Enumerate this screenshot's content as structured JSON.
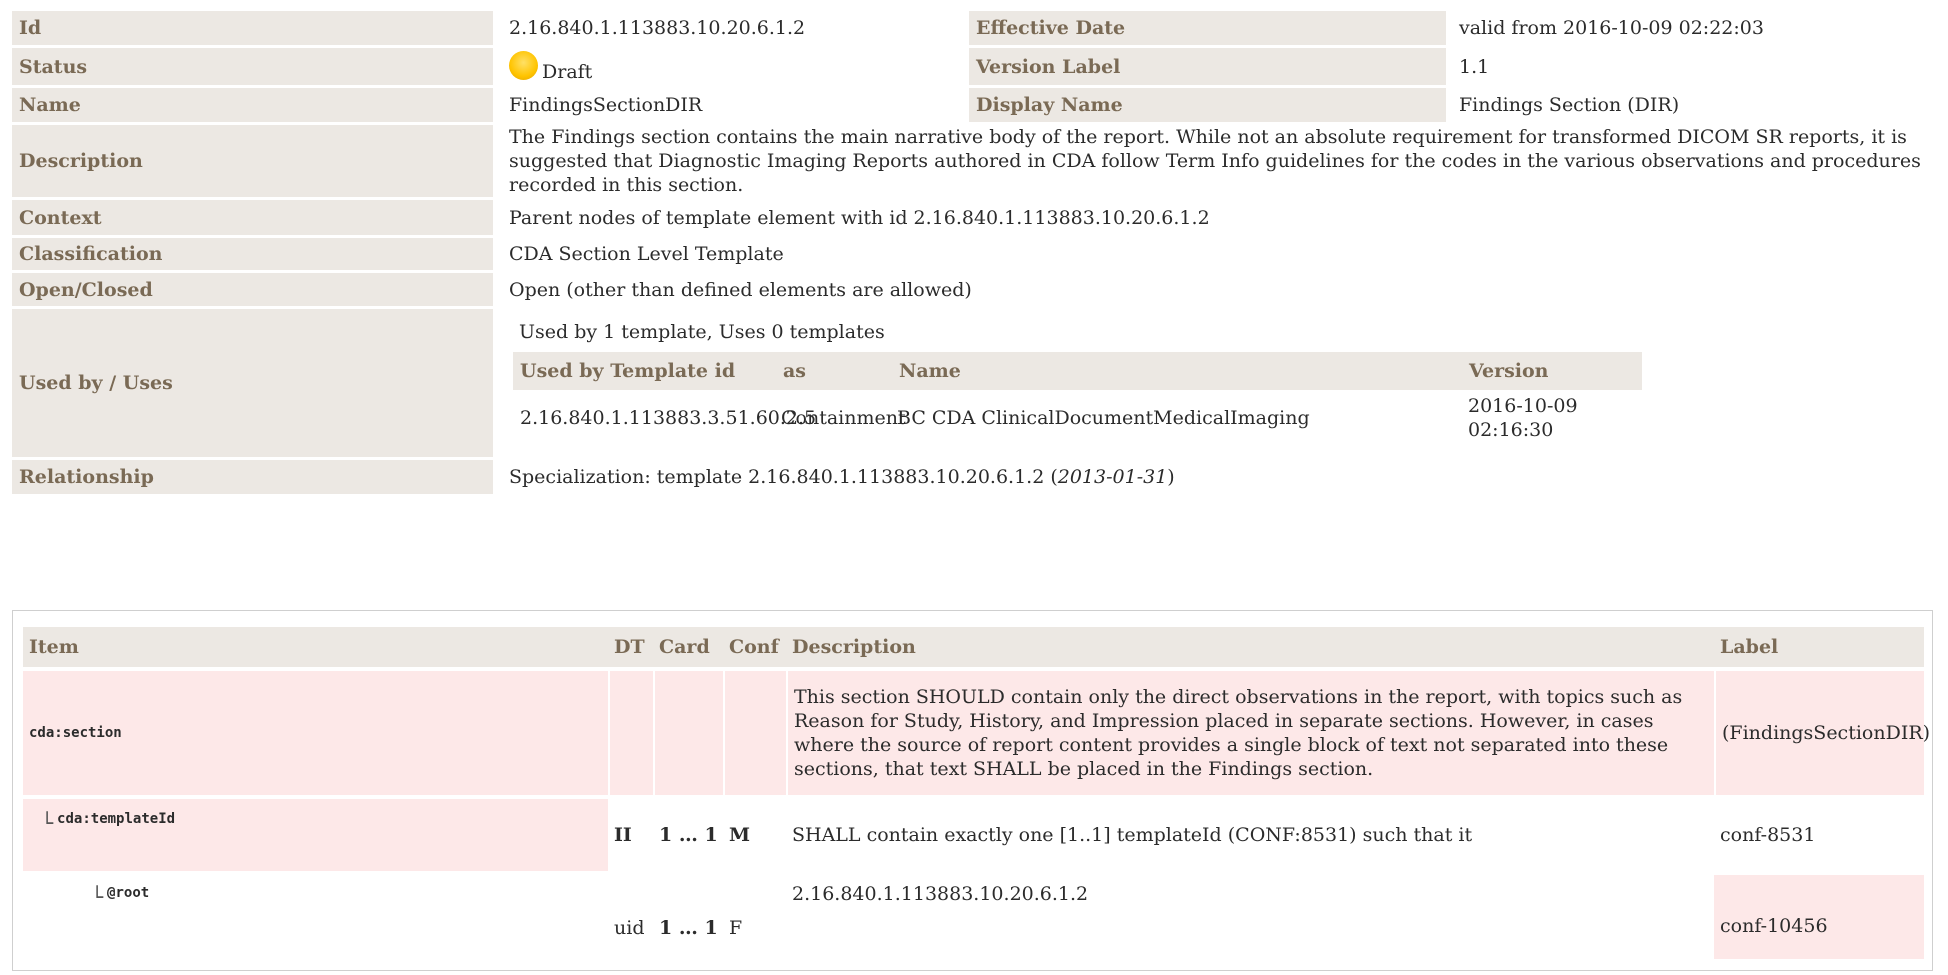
{
  "rows": {
    "id": {
      "label": "Id",
      "value": "2.16.840.1.113883.10.20.6.1.2",
      "label2": "Effective Date",
      "value2": "valid from 2016-10-09 02:22:03"
    },
    "status": {
      "label": "Status",
      "value": "Draft",
      "label2": "Version Label",
      "value2": "1.1",
      "status_color": "#ffc400"
    },
    "name": {
      "label": "Name",
      "value": "FindingsSectionDIR",
      "label2": "Display Name",
      "value2": "Findings Section (DIR)"
    },
    "description": {
      "label": "Description",
      "value": "The Findings section contains the main narrative body of the report. While not an absolute requirement for transformed DICOM SR reports, it is suggested that Diagnostic Imaging Reports authored in CDA follow Term Info guidelines for the codes in the various observations and procedures recorded in this section."
    },
    "context": {
      "label": "Context",
      "value": "Parent nodes of template element with id 2.16.840.1.113883.10.20.6.1.2"
    },
    "classification": {
      "label": "Classification",
      "value": "CDA Section Level Template"
    },
    "open_closed": {
      "label": "Open/Closed",
      "value": "Open (other than defined elements are allowed)"
    },
    "used_by": {
      "label": "Used by / Uses",
      "summary": "Used by 1 template, Uses 0 templates",
      "headers": [
        "Used by Template id",
        "as",
        "Name",
        "Version"
      ],
      "row": {
        "id": "2.16.840.1.113883.3.51.60.2.5",
        "as": "Containment",
        "name": "BC CDA ClinicalDocumentMedicalImaging",
        "version_line1": "2016-10-09",
        "version_line2": "02:16:30"
      }
    },
    "relationship": {
      "label": "Relationship",
      "prefix": "Specialization: template 2.16.840.1.113883.10.20.6.1.2 (",
      "date": "2013-01-31",
      "suffix": ")"
    }
  },
  "items": {
    "headers": [
      "Item",
      "DT",
      "Card",
      "Conf",
      "Description",
      "Label"
    ],
    "rows": [
      {
        "item": "cda:section",
        "dt": "",
        "card": "",
        "conf": "",
        "description": "This section SHOULD contain only the direct observations in the report, with topics such as Reason for Study, History, and Impression placed in separate sections. However, in cases where the source of report content provides a single block of text not separated into these sections, that text SHALL be placed in the Findings section.",
        "label": "(FindingsSectionDIR)"
      },
      {
        "tree": "└",
        "item": "cda:templateId",
        "dt": "II",
        "card": "1 … 1",
        "conf": "M",
        "description": "SHALL contain exactly one [1..1] templateId (CONF:8531) such that it",
        "label": "conf-8531"
      },
      {
        "tree": "└",
        "item": "@root",
        "dt": "uid",
        "card": "1 … 1",
        "conf": "F",
        "description": "2.16.840.1.113883.10.20.6.1.2",
        "label": "conf-10456"
      }
    ]
  },
  "colors": {
    "label_bg": "#ece8e3",
    "label_text": "#7a6a55",
    "row_highlight": "#fde8e8"
  }
}
